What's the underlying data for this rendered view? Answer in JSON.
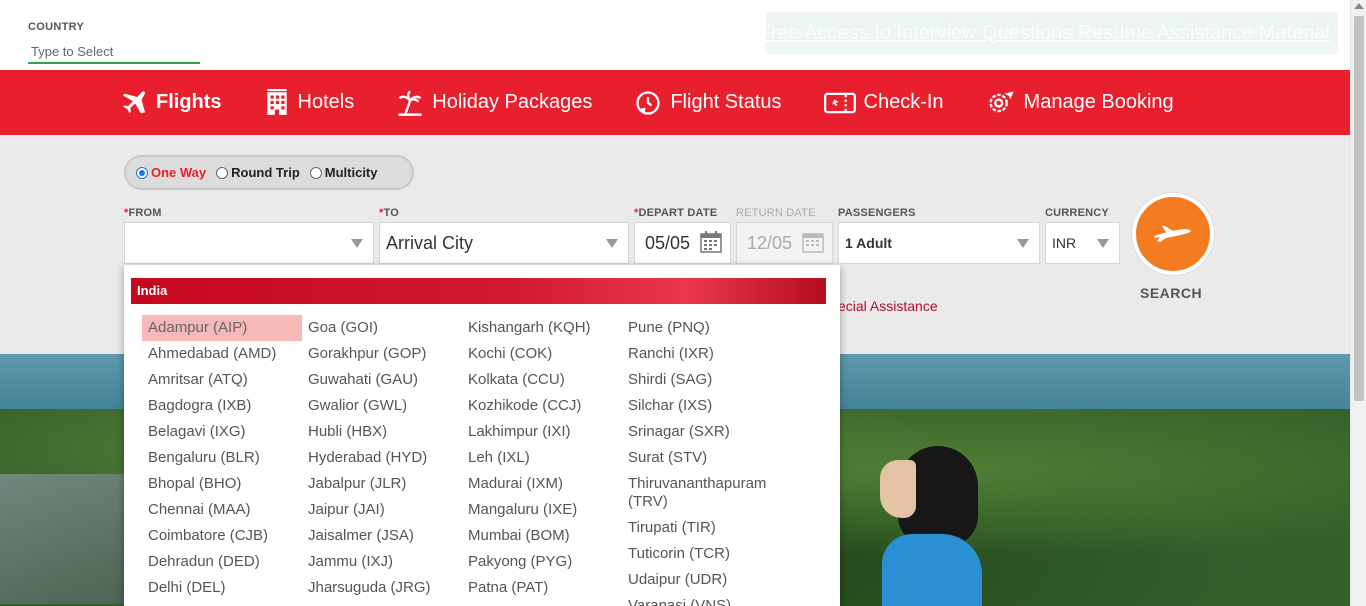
{
  "country": {
    "label": "COUNTRY",
    "placeholder": "Type to Select"
  },
  "promo": {
    "text": "Free Access to Interview Questions Resume Assistance Material"
  },
  "nav": {
    "items": [
      {
        "label": "Flights",
        "icon": "plane-icon"
      },
      {
        "label": "Hotels",
        "icon": "building-icon"
      },
      {
        "label": "Holiday Packages",
        "icon": "palm-tree-icon"
      },
      {
        "label": "Flight Status",
        "icon": "clock-plane-icon"
      },
      {
        "label": "Check-In",
        "icon": "boarding-pass-icon"
      },
      {
        "label": "Manage Booking",
        "icon": "gear-plane-icon"
      }
    ]
  },
  "trip_type": {
    "options": [
      "One Way",
      "Round Trip",
      "Multicity"
    ],
    "selected": "One Way"
  },
  "form": {
    "from_label": "FROM",
    "from_value": "",
    "to_label": "TO",
    "to_value": "Arrival City",
    "depart_label": "DEPART DATE",
    "depart_value": "05/05",
    "return_label": "RETURN DATE",
    "return_value": "12/05",
    "passengers_label": "PASSENGERS",
    "passengers_value": "1 Adult",
    "currency_label": "CURRENCY",
    "currency_value": "INR",
    "required_mark": "*"
  },
  "search_label": "SEARCH",
  "special_assistance": "ecial Assistance",
  "dropdown": {
    "region": "India",
    "highlighted": "Adampur (AIP)",
    "columns": [
      [
        "Adampur (AIP)",
        "Ahmedabad (AMD)",
        "Amritsar (ATQ)",
        "Bagdogra (IXB)",
        "Belagavi (IXG)",
        "Bengaluru (BLR)",
        "Bhopal (BHO)",
        "Chennai (MAA)",
        "Coimbatore (CJB)",
        "Dehradun (DED)",
        "Delhi (DEL)"
      ],
      [
        "Goa (GOI)",
        "Gorakhpur (GOP)",
        "Guwahati (GAU)",
        "Gwalior (GWL)",
        "Hubli (HBX)",
        "Hyderabad (HYD)",
        "Jabalpur (JLR)",
        "Jaipur (JAI)",
        "Jaisalmer (JSA)",
        "Jammu (IXJ)",
        "Jharsuguda (JRG)"
      ],
      [
        "Kishangarh (KQH)",
        "Kochi (COK)",
        "Kolkata (CCU)",
        "Kozhikode (CCJ)",
        "Lakhimpur (IXI)",
        "Leh (IXL)",
        "Madurai (IXM)",
        "Mangaluru (IXE)",
        "Mumbai (BOM)",
        "Pakyong (PYG)",
        "Patna (PAT)"
      ],
      [
        "Pune (PNQ)",
        "Ranchi (IXR)",
        "Shirdi (SAG)",
        "Silchar (IXS)",
        "Srinagar (SXR)",
        "Surat (STV)",
        "Thiruvananthapuram (TRV)",
        "Tirupati (TIR)",
        "Tuticorin (TCR)",
        "Udaipur (UDR)",
        "Varanasi (VNS)"
      ]
    ]
  },
  "colors": {
    "brand_red": "#e8202d",
    "search_orange": "#f47c20",
    "highlight": "#f6b8b8",
    "accent_green": "#2ea44f"
  }
}
